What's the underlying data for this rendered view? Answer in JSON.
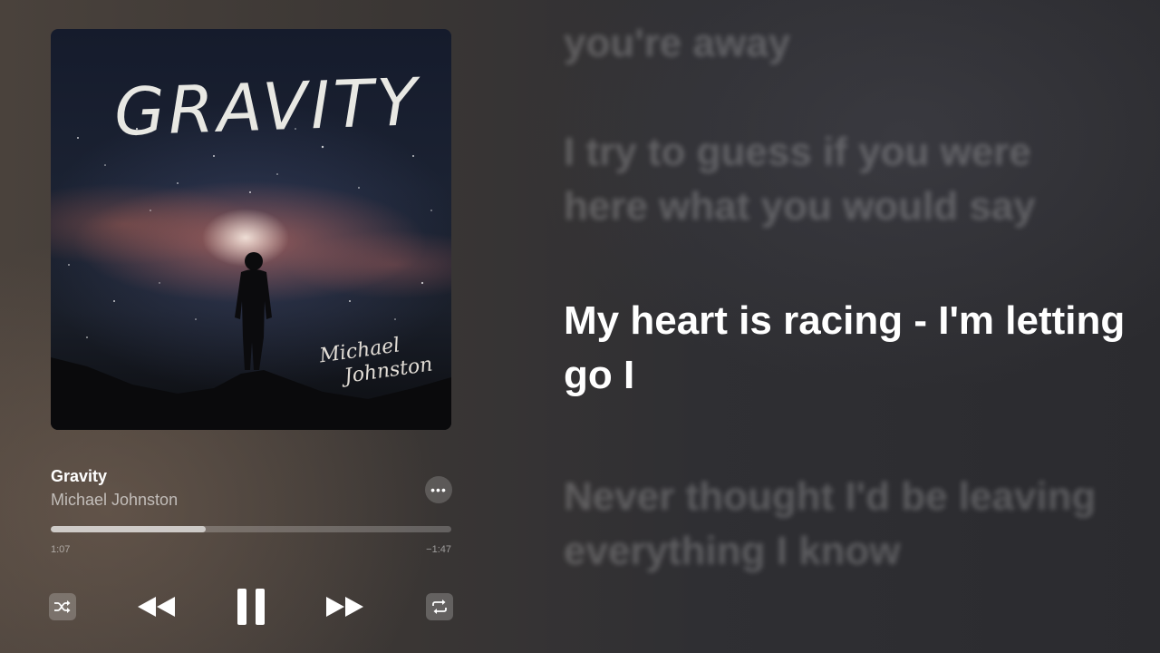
{
  "now_playing": {
    "artwork": {
      "title_text": "GRAVITY",
      "artist_line1": "Michael",
      "artist_line2": "Johnston"
    },
    "title": "Gravity",
    "artist": "Michael Johnston",
    "more_icon": "ellipsis-icon",
    "more_glyph": "•••",
    "progress_fraction": 0.387,
    "time_elapsed": "1:07",
    "time_remaining": "−1:47"
  },
  "controls": {
    "shuffle_icon": "shuffle-icon",
    "rewind_icon": "rewind-icon",
    "pause_icon": "pause-icon",
    "forward_icon": "fast-forward-icon",
    "repeat_icon": "repeat-icon"
  },
  "lyrics": [
    {
      "text": "you're away",
      "state": "past"
    },
    {
      "text": "I try to guess if you were here what you would say",
      "state": "past"
    },
    {
      "text": "My heart is racing - I'm letting go I",
      "state": "current"
    },
    {
      "text": "Never thought I'd be leaving everything I know",
      "state": "upcoming"
    }
  ],
  "colors": {
    "lyric_active": "#ffffff",
    "lyric_dim": "rgba(255,255,255,0.22)",
    "accent_control": "#ffffff"
  }
}
